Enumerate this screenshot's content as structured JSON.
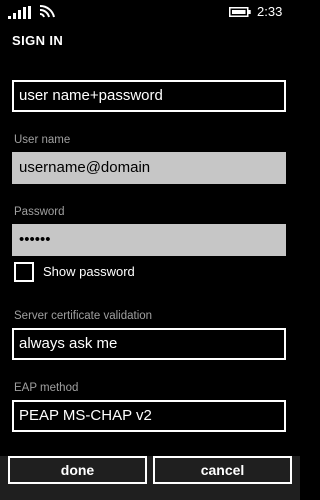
{
  "status_bar": {
    "time": "2:33",
    "icons": [
      "signal-icon",
      "wifi-icon",
      "battery-icon"
    ]
  },
  "page": {
    "title": "SIGN IN"
  },
  "form": {
    "sign_in_method_value": "user name+password",
    "username_label": "User name",
    "username_value": "username@domain",
    "password_label": "Password",
    "password_value": "••••••",
    "show_password_label": "Show password",
    "show_password_checked": false,
    "cert_label": "Server certificate validation",
    "cert_value": "always ask me",
    "eap_label": "EAP method",
    "eap_value": "PEAP MS-CHAP v2"
  },
  "app_bar": {
    "done_label": "done",
    "cancel_label": "cancel"
  },
  "colors": {
    "background": "#000000",
    "field_disabled": "#c6c6c6",
    "label": "#a0a0a0",
    "app_bar": "#1f1f1f"
  }
}
